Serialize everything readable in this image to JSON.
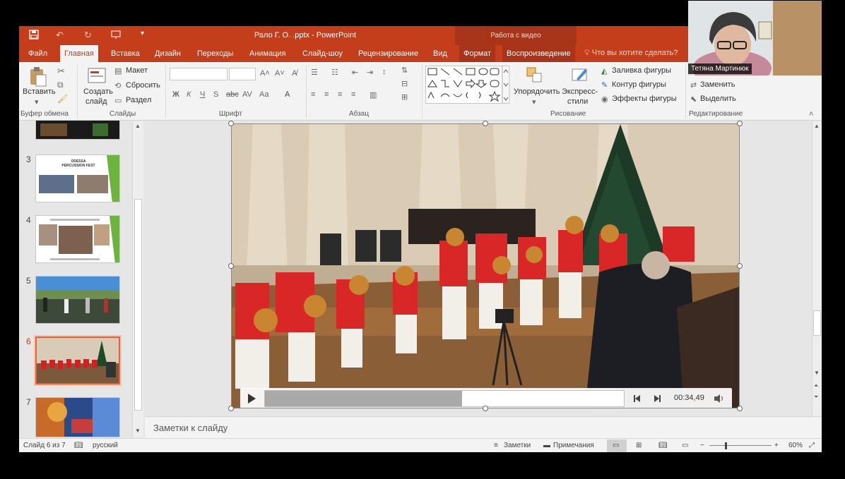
{
  "titlebar": {
    "document_title": "Рало Г. О. .pptx - PowerPoint",
    "contextual_group": "Работа с видео"
  },
  "tabs": [
    {
      "label": "Файл"
    },
    {
      "label": "Главная"
    },
    {
      "label": "Вставка"
    },
    {
      "label": "Дизайн"
    },
    {
      "label": "Переходы"
    },
    {
      "label": "Анимация"
    },
    {
      "label": "Слайд-шоу"
    },
    {
      "label": "Рецензирование"
    },
    {
      "label": "Вид"
    },
    {
      "label": "Формат"
    },
    {
      "label": "Воспроизведение"
    }
  ],
  "tell_me": "Что вы хотите сделать?",
  "ribbon": {
    "clipboard": {
      "paste": "Вставить",
      "group": "Буфер обмена"
    },
    "slides": {
      "new_slide_1": "Создать",
      "new_slide_2": "слайд",
      "layout": "Макет",
      "reset": "Сбросить",
      "section": "Раздел",
      "group": "Слайды"
    },
    "font": {
      "group": "Шрифт",
      "bold": "Ж",
      "italic": "К",
      "underline": "Ч",
      "strike": "S",
      "case": "Аа"
    },
    "paragraph": {
      "group": "Абзац"
    },
    "drawing": {
      "arrange": "Упорядочить",
      "quick_styles_1": "Экспресс-",
      "quick_styles_2": "стили",
      "fill": "Заливка фигуры",
      "outline": "Контур фигуры",
      "effects": "Эффекты фигуры",
      "group": "Рисование"
    },
    "editing": {
      "replace": "Заменить",
      "select": "Выделить",
      "group": "Редактирование"
    }
  },
  "thumbnails": [
    {
      "num": "3",
      "caption": "ODESSA PERCUSSION FEST"
    },
    {
      "num": "4",
      "caption": ""
    },
    {
      "num": "5",
      "caption": ""
    },
    {
      "num": "6",
      "caption": ""
    },
    {
      "num": "7",
      "caption": ""
    }
  ],
  "video": {
    "time": "00:34,49",
    "progress": 0.55
  },
  "notes_placeholder": "Заметки к слайду",
  "statusbar": {
    "slide_info": "Слайд 6 из 7",
    "language": "русский",
    "notes_btn": "Заметки",
    "comments_btn": "Примечания",
    "zoom": "60%"
  },
  "webcam": {
    "participant_name": "Тетяна Мартинюк"
  },
  "colors": {
    "accent": "#c43e1c",
    "selected_thumb": "#e0643e"
  }
}
